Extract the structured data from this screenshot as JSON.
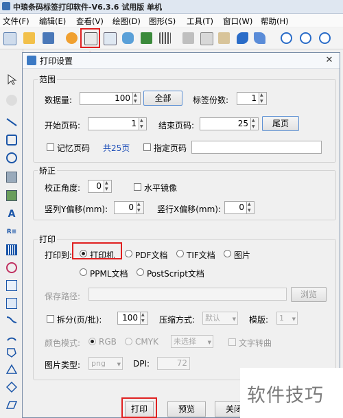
{
  "app": {
    "title": "中琅条码标签打印软件-V6.3.6 试用版 单机"
  },
  "menu": [
    "文件(F)",
    "编辑(E)",
    "查看(V)",
    "绘图(D)",
    "图形(S)",
    "工具(T)",
    "窗口(W)",
    "帮助(H)"
  ],
  "dialog": {
    "title": "打印设置",
    "close": "✕",
    "range": {
      "legend": "范围",
      "quantity_label": "数据量:",
      "quantity_value": "100",
      "all_button": "全部",
      "copies_label": "标签份数:",
      "copies_value": "1",
      "start_label": "开始页码:",
      "start_value": "1",
      "end_label": "结束页码:",
      "end_value": "25",
      "last_button": "尾页",
      "remember_label": "记忆页码",
      "total_pages": "共25页",
      "specify_label": "指定页码"
    },
    "correction": {
      "legend": "矫正",
      "angle_label": "校正角度:",
      "angle_value": "0",
      "mirror_label": "水平镜像",
      "col_y_label": "竖列Y偏移(mm):",
      "col_y_value": "0",
      "row_x_label": "竖行X偏移(mm):",
      "row_x_value": "0"
    },
    "print": {
      "legend": "打印",
      "print_to_label": "打印到:",
      "options": [
        "打印机",
        "PDF文档",
        "TIF文档",
        "图片",
        "PPML文档",
        "PostScript文档"
      ],
      "save_path_label": "保存路径:",
      "browse_button": "浏览",
      "split_label": "拆分(页/批):",
      "split_value": "100",
      "compress_label": "压缩方式:",
      "compress_value": "默认",
      "template_label": "模版:",
      "template_value": "1",
      "color_mode_label": "颜色模式:",
      "rgb_label": "RGB",
      "cmyk_label": "CMYK",
      "color_dd_value": "未选择",
      "text_curve_label": "文字转曲",
      "image_type_label": "图片类型:",
      "image_type_value": "png",
      "dpi_label": "DPI:",
      "dpi_value": "72"
    },
    "footer": {
      "print_button": "打印",
      "preview_button": "预览",
      "close_button": "关闭"
    }
  },
  "watermark": "软件技巧"
}
